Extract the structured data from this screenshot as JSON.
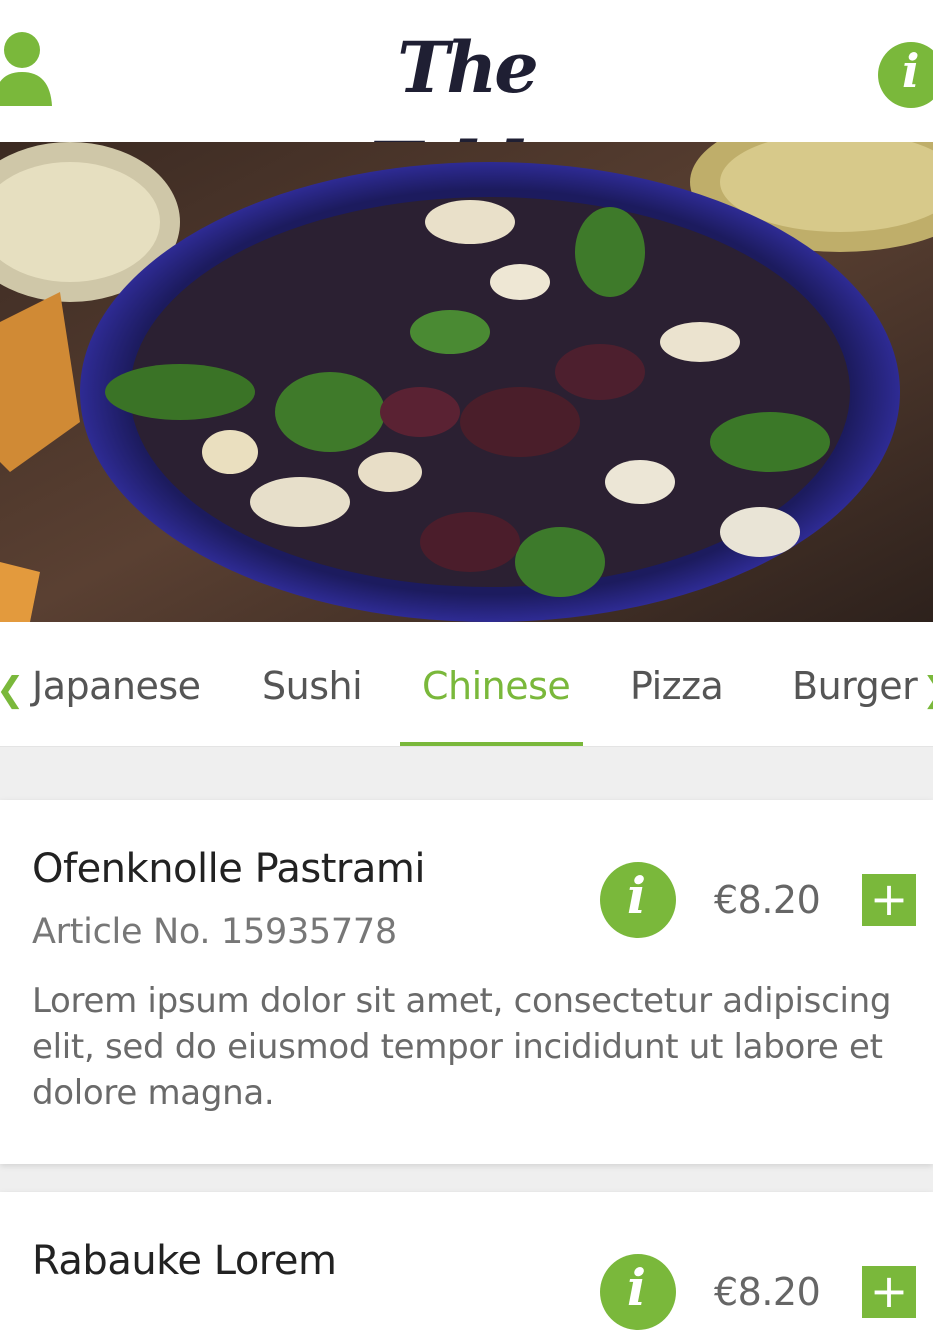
{
  "app": {
    "title": "The Table",
    "accent_color": "#7ab83b"
  },
  "header": {
    "user_icon": "user-icon",
    "info_icon": "info-icon",
    "info_glyph": "i"
  },
  "hero": {
    "image_subject": "salad bowl photo"
  },
  "tabs": {
    "items": [
      {
        "label": "Japanese"
      },
      {
        "label": "Sushi"
      },
      {
        "label": "Chinese"
      },
      {
        "label": "Pizza"
      },
      {
        "label": "Burger"
      }
    ],
    "active": "Chinese",
    "prev_icon": "chevron-left-icon",
    "next_icon": "chevron-right-icon"
  },
  "items": [
    {
      "name": "Ofenknolle Pastrami",
      "article": "Article No. 15935778",
      "description": "Lorem ipsum dolor sit amet, consectetur adipiscing elit, sed do eiusmod tempor incididunt ut labore et dolore magna.",
      "price": "€8.20",
      "add_label": "+",
      "info_glyph": "i"
    },
    {
      "name": "Rabauke Lorem",
      "price": "€8.20",
      "add_label": "+",
      "info_glyph": "i"
    }
  ]
}
